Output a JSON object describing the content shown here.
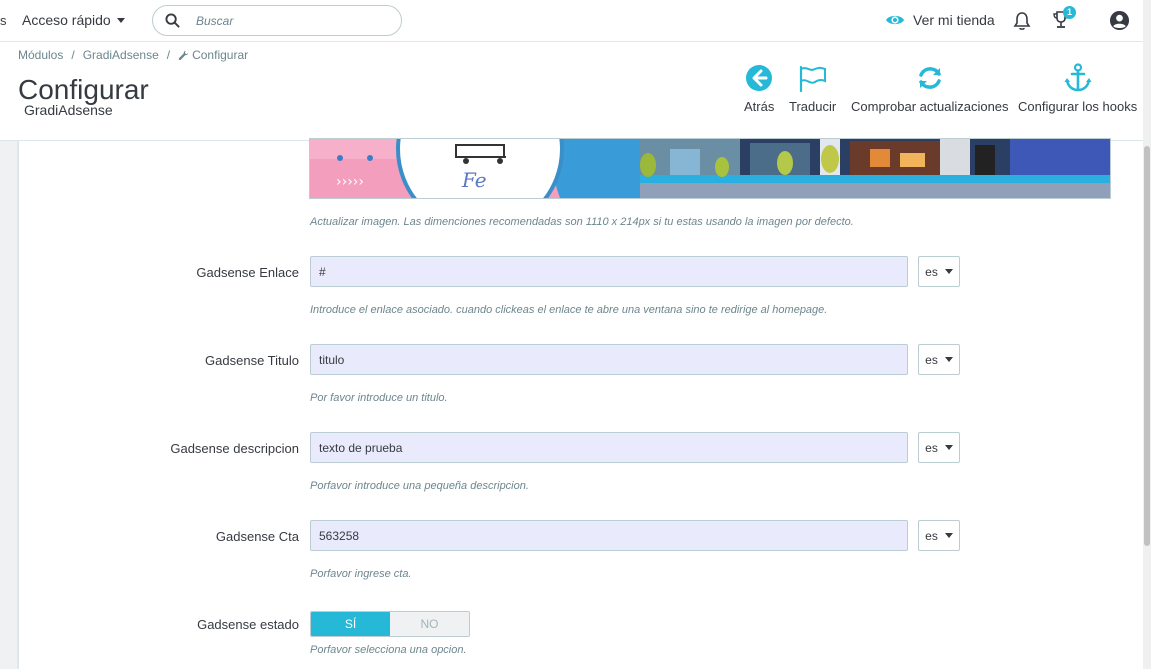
{
  "topbar": {
    "cut_text": "s",
    "quick_access": "Acceso rápido",
    "search_placeholder": "Buscar",
    "view_store": "Ver mi tienda",
    "notification_count": "1"
  },
  "breadcrumb": {
    "items": [
      "Módulos",
      "GradiAdsense",
      "Configurar"
    ],
    "separator": "/"
  },
  "header": {
    "title": "Configurar",
    "subtitle": "GradiAdsense"
  },
  "toolbar": {
    "back": "Atrás",
    "translate": "Traducir",
    "check_updates": "Comprobar actualizaciones",
    "configure_hooks": "Configurar los hooks"
  },
  "form": {
    "image_help": "Actualizar imagen. Las dimenciones recomendadas son 1110 x 214px si tu estas usando la imagen por defecto.",
    "fields": [
      {
        "label": "Gadsense Enlace",
        "value": "#",
        "lang": "es",
        "help": "Introduce el enlace asociado. cuando clickeas el enlace te abre una ventana sino te redirige al homepage."
      },
      {
        "label": "Gadsense Titulo",
        "value": "titulo",
        "lang": "es",
        "help": "Por favor introduce un titulo."
      },
      {
        "label": "Gadsense descripcion",
        "value": "texto de prueba",
        "lang": "es",
        "help": "Porfavor introduce una pequeña descripcion."
      },
      {
        "label": "Gadsense Cta",
        "value": "563258",
        "lang": "es",
        "help": "Porfavor ingrese cta."
      }
    ],
    "status": {
      "label": "Gadsense estado",
      "yes": "SÍ",
      "no": "NO",
      "selected": "SÍ",
      "help": "Porfavor selecciona una opcion."
    }
  },
  "colors": {
    "accent": "#25b9d7",
    "input_bg": "#e9ebfc",
    "text": "#363a41",
    "muted": "#6c868e"
  },
  "icons": [
    "search-icon",
    "eye-icon",
    "bell-icon",
    "trophy-icon",
    "account-icon",
    "back-arrow-icon",
    "flag-icon",
    "refresh-icon",
    "anchor-icon",
    "wrench-icon"
  ]
}
